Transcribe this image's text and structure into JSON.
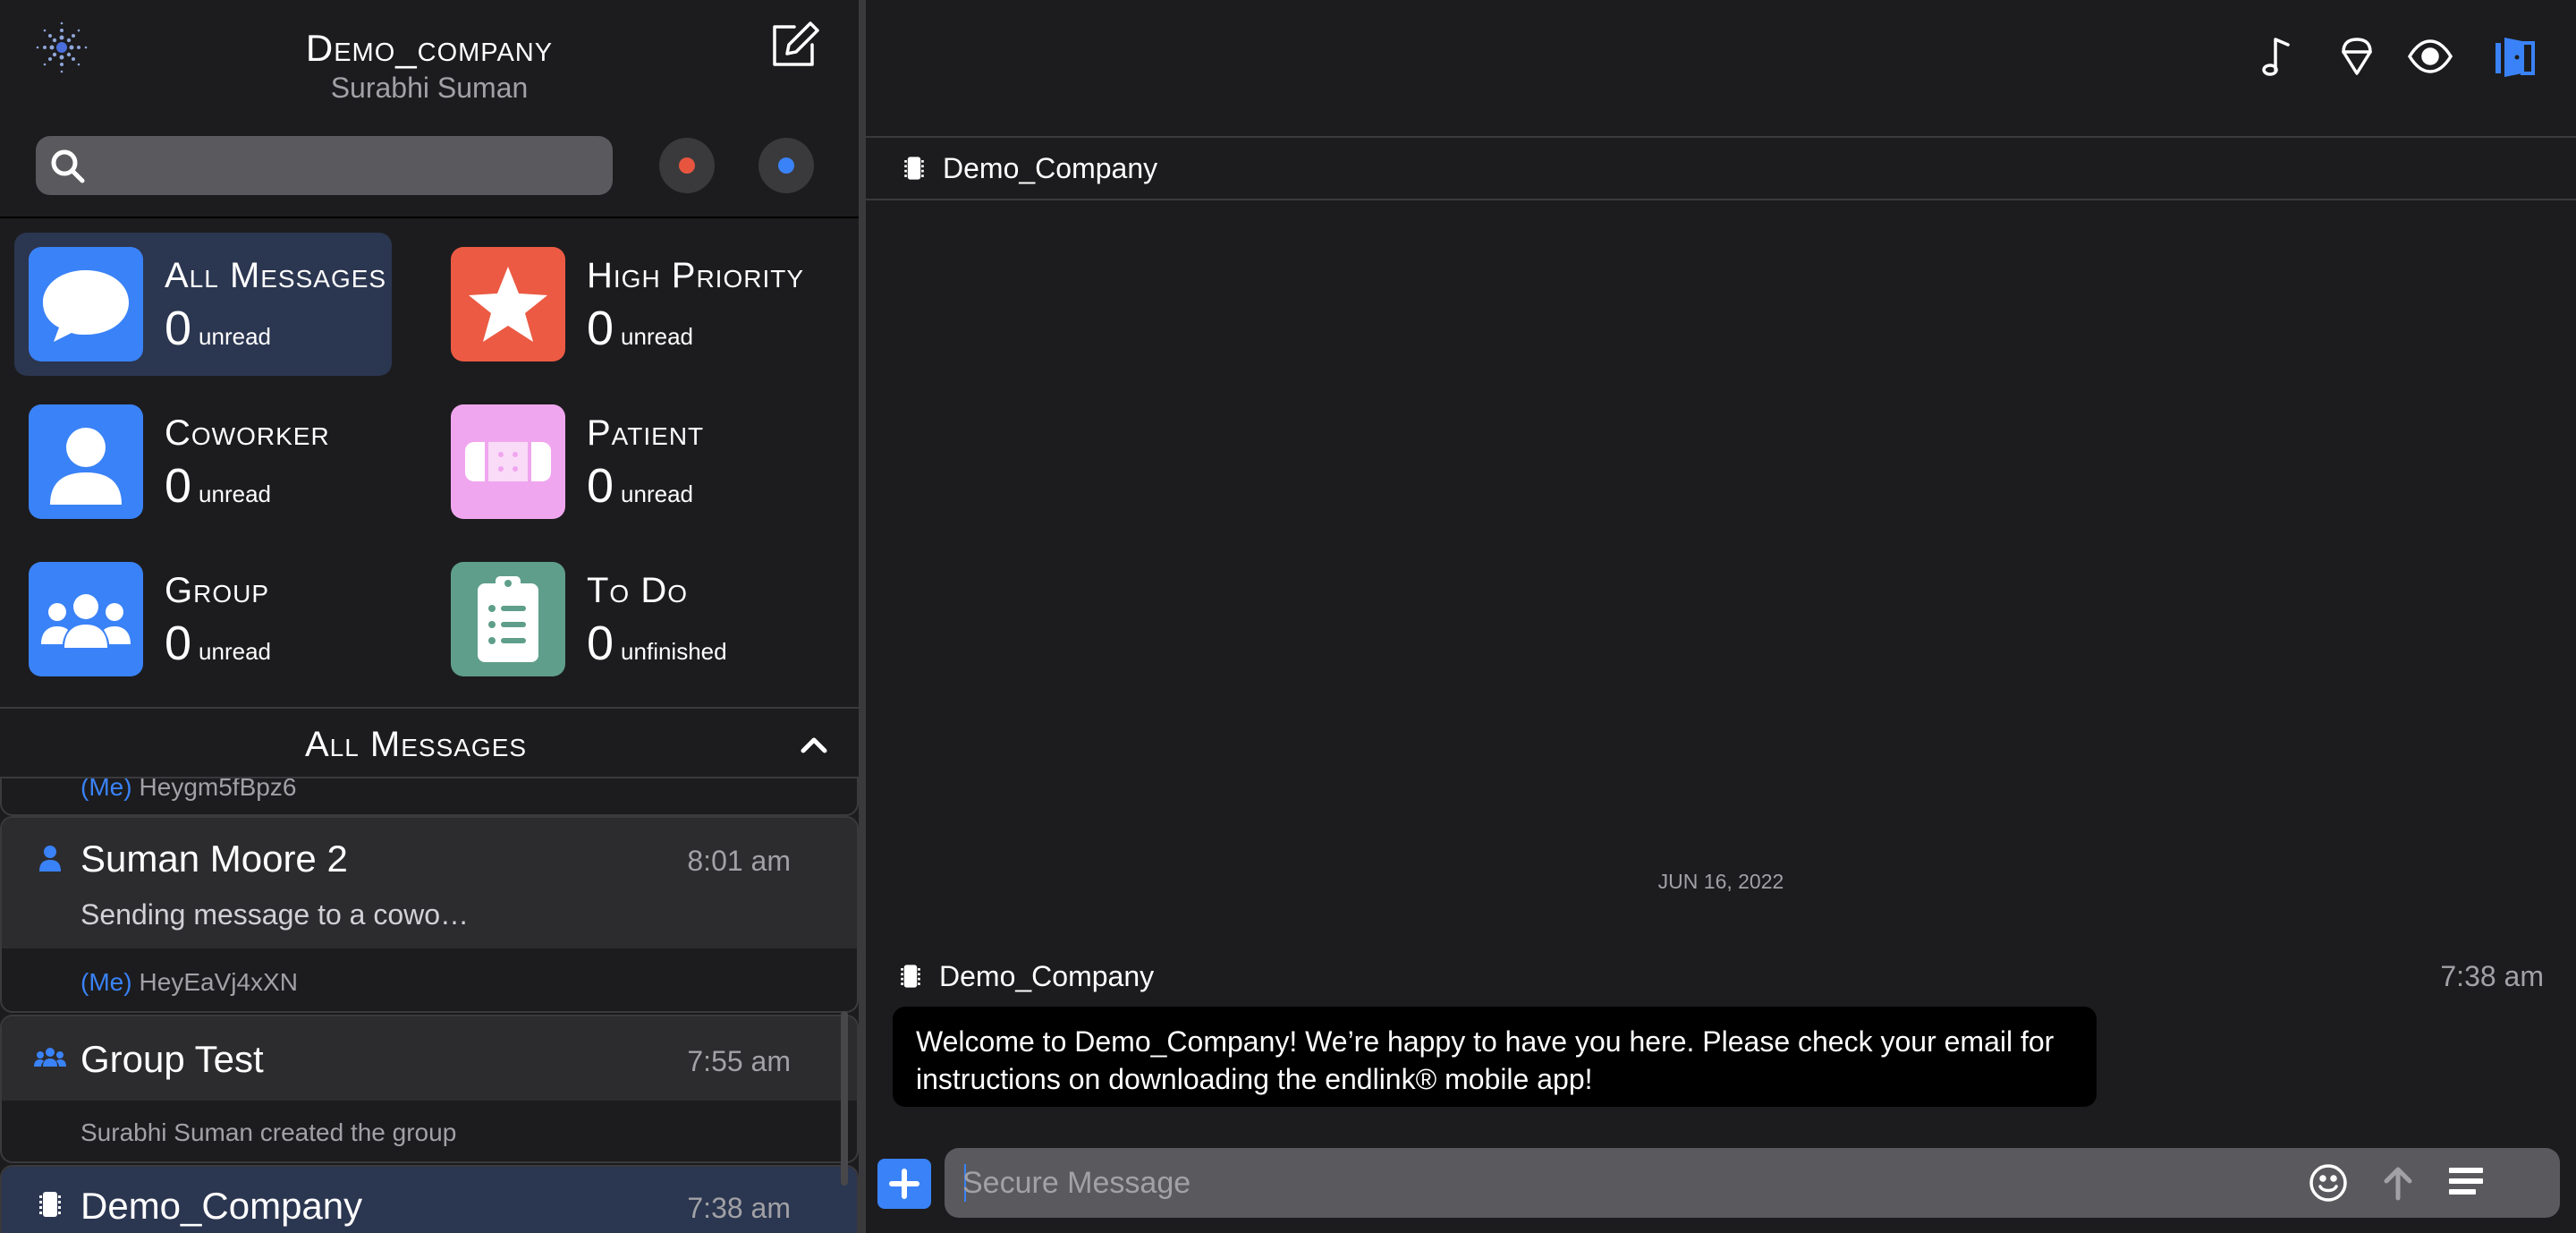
{
  "header": {
    "company": "Demo_company",
    "user": "Surabhi Suman"
  },
  "search": {
    "placeholder": ""
  },
  "status_colors": {
    "red": "#e8553f",
    "blue": "#3a82f7"
  },
  "tiles": [
    {
      "title": "All Messages",
      "count": "0",
      "unit": "unread",
      "color": "#3a82f7",
      "icon": "speech-bubble-icon"
    },
    {
      "title": "High Priority",
      "count": "0",
      "unit": "unread",
      "color": "#ec5a44",
      "icon": "star-icon"
    },
    {
      "title": "Coworker",
      "count": "0",
      "unit": "unread",
      "color": "#3a82f7",
      "icon": "person-icon"
    },
    {
      "title": "Patient",
      "count": "0",
      "unit": "unread",
      "color": "#f0a6ee",
      "icon": "bandage-icon"
    },
    {
      "title": "Group",
      "count": "0",
      "unit": "unread",
      "color": "#3a82f7",
      "icon": "group-icon"
    },
    {
      "title": "To Do",
      "count": "0",
      "unit": "unfinished",
      "color": "#5e9e8a",
      "icon": "clipboard-icon"
    }
  ],
  "section": {
    "title": "All Messages"
  },
  "conversations": [
    {
      "name": "",
      "time": "",
      "preview": "",
      "me": "(Me)",
      "last": "Heygm5fBpz6"
    },
    {
      "name": "Suman Moore 2",
      "time": "8:01 am",
      "preview": "Sending message to a cowo…",
      "me": "(Me)",
      "last": "HeyEaVj4xXN",
      "icon": "person-icon"
    },
    {
      "name": "Group Test",
      "time": "7:55 am",
      "preview": "",
      "last": "Surabhi Suman created the group",
      "icon": "group-icon"
    },
    {
      "name": "Demo_Company",
      "time": "7:38 am",
      "icon": "company-icon"
    }
  ],
  "chat": {
    "title": "Demo_Company",
    "date": "JUN 16, 2022",
    "message": {
      "sender": "Demo_Company",
      "time": "7:38 am",
      "text": "Welcome to Demo_Company! We’re happy to have you here. Please check your email for instructions on downloading the endlink® mobile app!"
    },
    "composer_placeholder": "Secure Message"
  },
  "toolbar_icons": [
    "music-note-icon",
    "ice-cream-icon",
    "eye-icon",
    "exit-door-icon"
  ]
}
